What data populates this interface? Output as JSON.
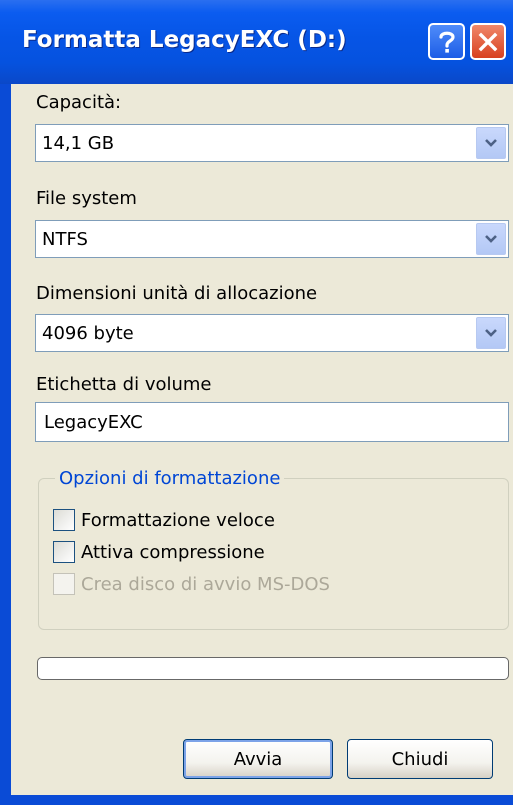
{
  "window": {
    "title": "Formatta LegacyEXC (D:)",
    "help_icon": "help-question-icon",
    "close_icon": "close-x-icon",
    "frame_color": "#0a4bd6",
    "client_bg": "#ece9d8"
  },
  "capacity": {
    "label": "Capacità:",
    "value": "14,1 GB"
  },
  "filesystem": {
    "label": "File system",
    "value": "NTFS"
  },
  "allocation": {
    "label": "Dimensioni unità di allocazione",
    "value": "4096 byte"
  },
  "volume": {
    "label": "Etichetta di volume",
    "value": "LegacyEXC"
  },
  "options": {
    "legend": "Opzioni di formattazione",
    "legend_color": "#0046d5",
    "quick_format": {
      "label": "Formattazione veloce",
      "checked": false,
      "enabled": true
    },
    "compression": {
      "label": "Attiva compressione",
      "checked": false,
      "enabled": true
    },
    "msdos_boot": {
      "label": "Crea disco di avvio MS-DOS",
      "checked": false,
      "enabled": false
    }
  },
  "progress": {
    "fraction": 0
  },
  "buttons": {
    "start_label": "Avvia",
    "close_label": "Chiudi"
  }
}
